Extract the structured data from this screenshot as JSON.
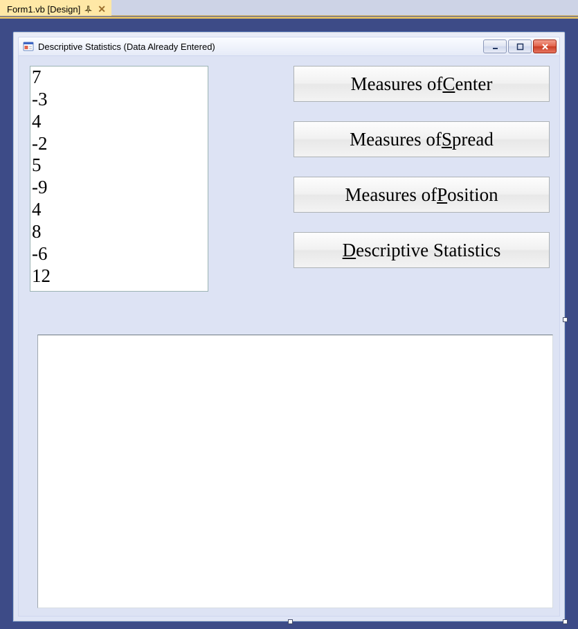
{
  "ide": {
    "tab_label": "Form1.vb [Design]"
  },
  "form": {
    "title": "Descriptive Statistics (Data Already Entered)"
  },
  "listbox": {
    "items": [
      "7",
      "-3",
      "4",
      "-2",
      "5",
      "-9",
      "4",
      "8",
      "-6",
      "12"
    ]
  },
  "buttons": {
    "center": {
      "pre": "Measures of ",
      "mnemonic": "C",
      "post": "enter"
    },
    "spread": {
      "pre": "Measures of ",
      "mnemonic": "S",
      "post": "pread"
    },
    "position": {
      "pre": "Measures of ",
      "mnemonic": "P",
      "post": "osition"
    },
    "descriptive": {
      "pre": "",
      "mnemonic": "D",
      "post": "escriptive Statistics"
    }
  }
}
